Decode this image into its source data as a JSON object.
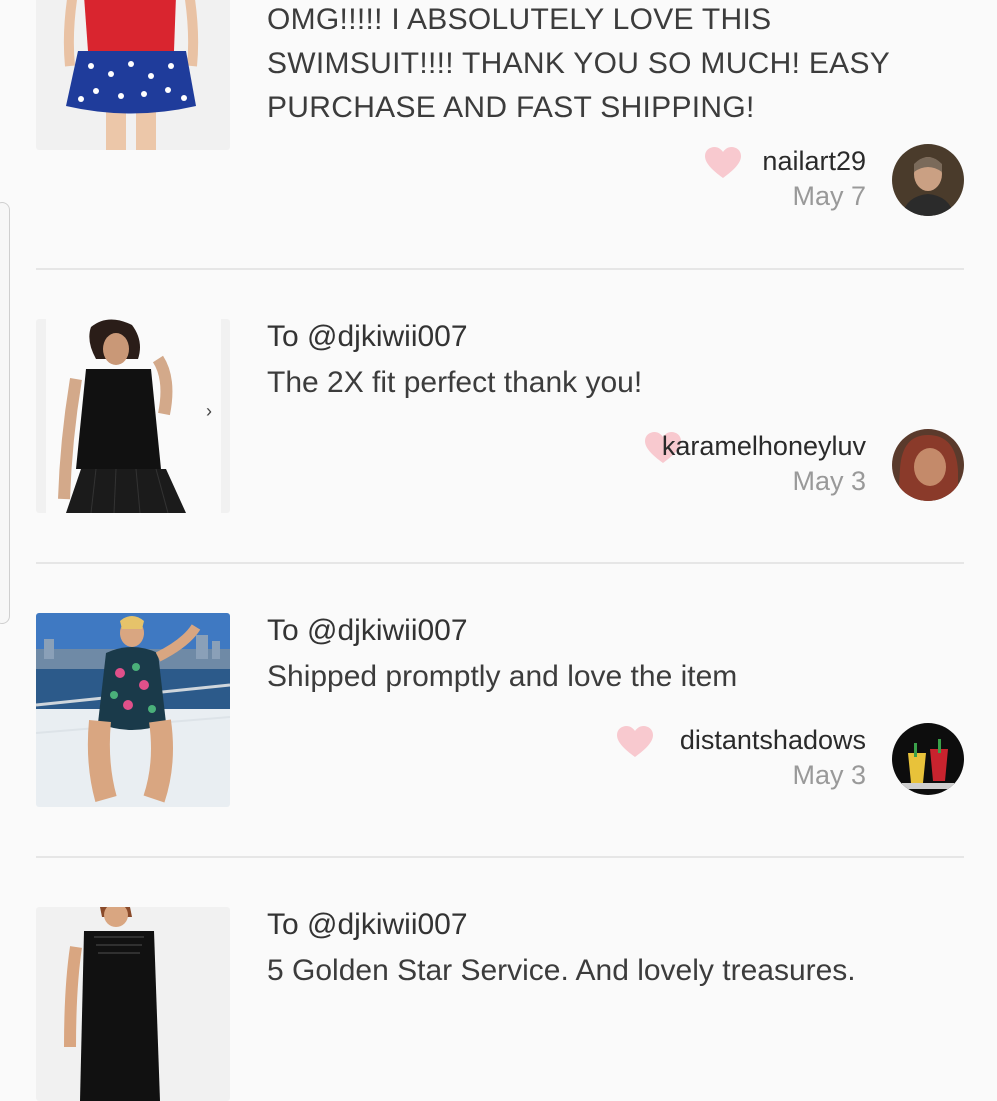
{
  "reviews": [
    {
      "recipient": "",
      "comment": "OMG!!!!! I ABSOLUTELY LOVE THIS SWIMSUIT!!!! THANK YOU SO MUCH! EASY PURCHASE AND FAST SHIPPING!",
      "username": "nailart29",
      "date": "May 7",
      "thumbnail": "red-blue-star-swimsuit-photo",
      "avatar": "user-avatar-photo"
    },
    {
      "recipient": "To @djkiwii007",
      "comment": "The 2X fit perfect thank you!",
      "username": "karamelhoneyluv",
      "date": "May 3",
      "thumbnail": "black-lace-fringe-top-photo",
      "avatar": "user-avatar-photo"
    },
    {
      "recipient": "To @djkiwii007",
      "comment": "Shipped promptly and love the item",
      "username": "distantshadows",
      "date": "May 3",
      "thumbnail": "floral-swimsuit-on-boat-photo",
      "avatar": "cocktails-avatar-photo"
    },
    {
      "recipient": "To @djkiwii007",
      "comment": "5 Golden Star Service. And lovely treasures.",
      "username": "",
      "date": "",
      "thumbnail": "black-crochet-top-photo",
      "avatar": ""
    }
  ],
  "colors": {
    "background": "#fafafa",
    "heart": "#f8c9cf",
    "divider": "#e6e6e6",
    "muted_text": "#999999"
  },
  "icons": {
    "like": "heart-icon",
    "carousel_next": "chevron-right-icon"
  }
}
